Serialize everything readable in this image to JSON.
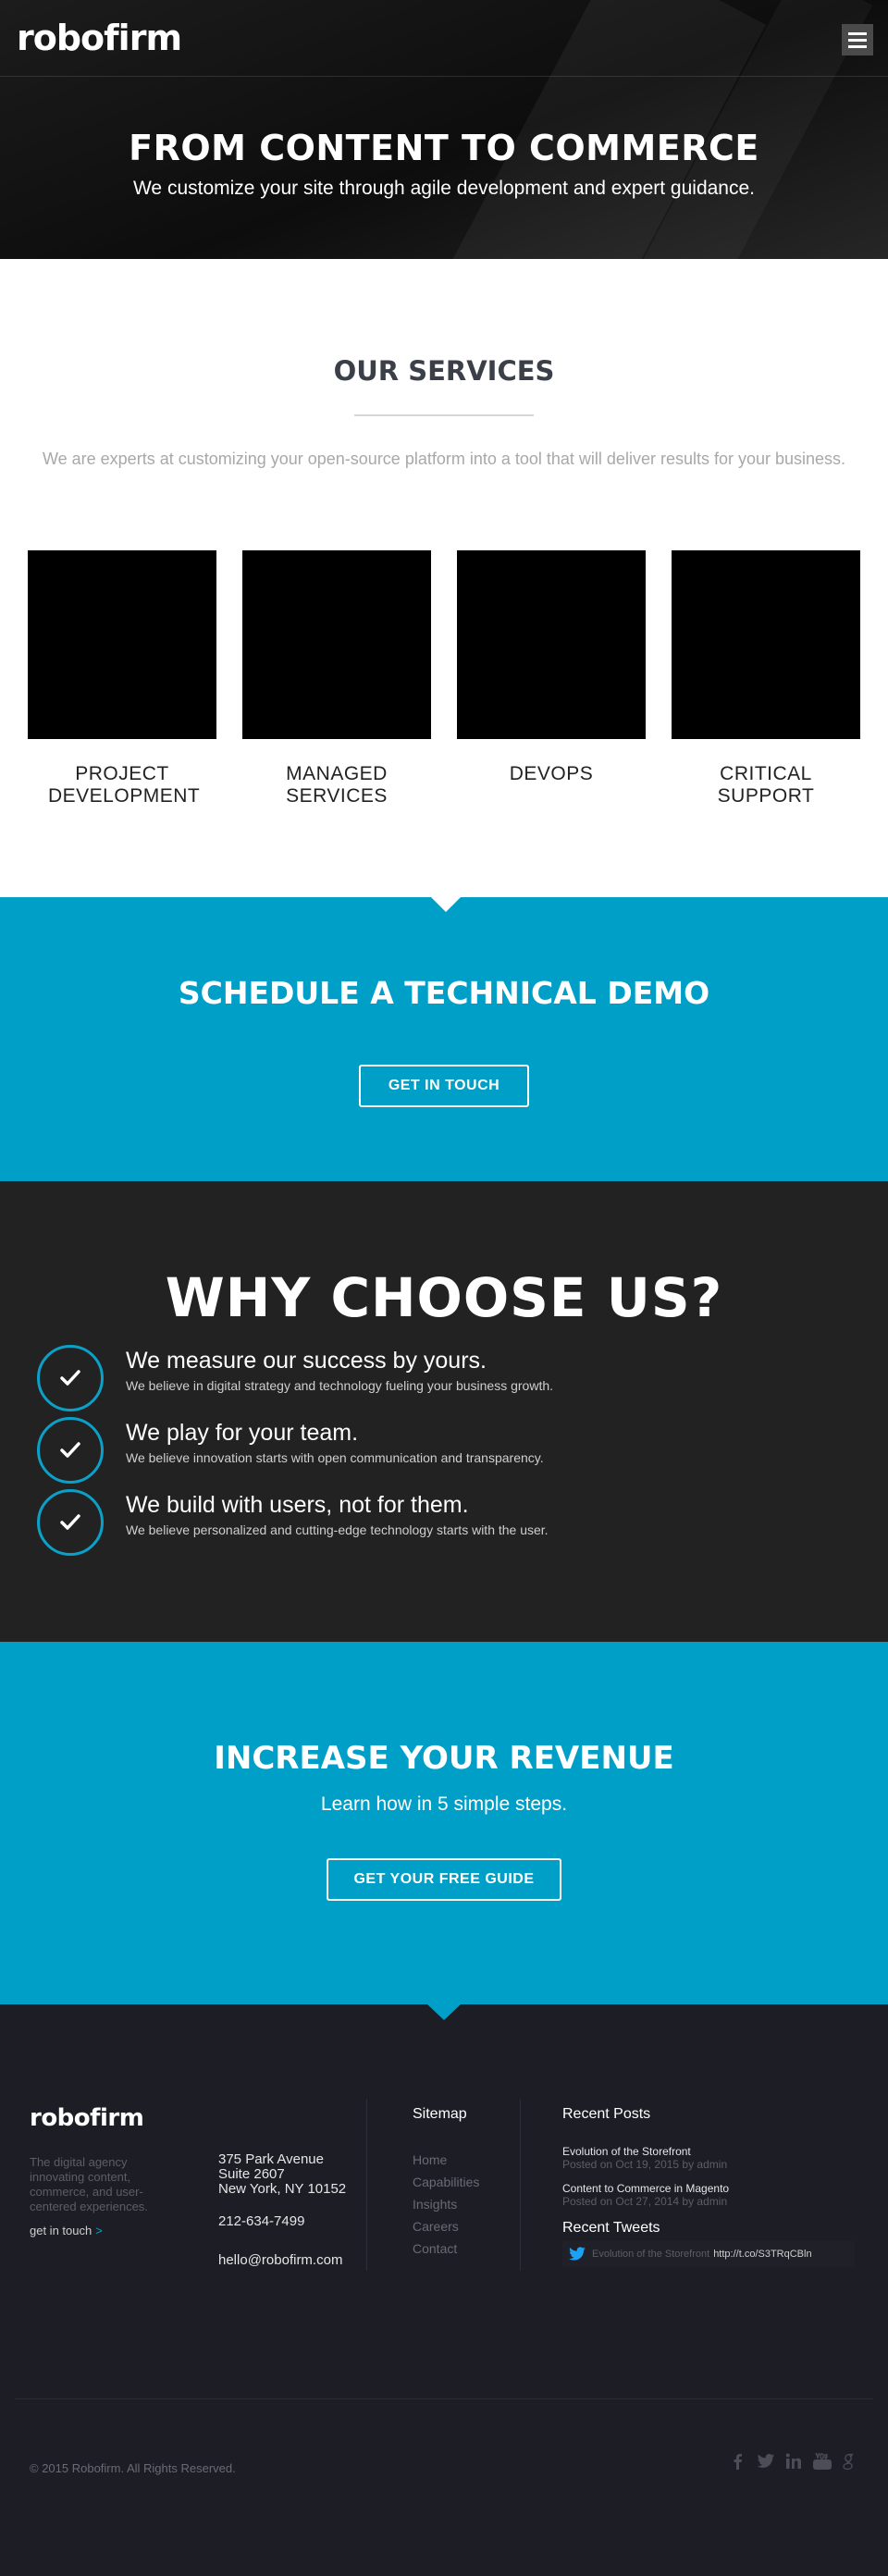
{
  "brand": {
    "logo": "robofirm",
    "accent": "#0aa0c8"
  },
  "hero": {
    "title": "FROM CONTENT TO COMMERCE",
    "subtitle": "We customize your site through agile development and expert guidance."
  },
  "services": {
    "title": "OUR SERVICES",
    "intro": "We are experts at customizing your open-source platform into a tool that will deliver results for your business.",
    "items": [
      {
        "label": "PROJECT DEVELOPMENT"
      },
      {
        "label": "MANAGED SERVICES"
      },
      {
        "label": "DEVOPS"
      },
      {
        "label": "CRITICAL SUPPORT"
      }
    ]
  },
  "demo": {
    "title": "SCHEDULE A TECHNICAL DEMO",
    "button": "GET IN TOUCH"
  },
  "why": {
    "title": "WHY CHOOSE US?",
    "items": [
      {
        "head": "We measure our success by yours.",
        "desc": "We believe in digital strategy and technology fueling your business growth."
      },
      {
        "head": "We play for your team.",
        "desc": "We believe innovation starts with open communication and transparency."
      },
      {
        "head": "We build with users, not for them.",
        "desc": "We believe personalized and cutting-edge technology starts with the user."
      }
    ]
  },
  "revenue": {
    "title": "INCREASE YOUR REVENUE",
    "subtitle": "Learn how in 5 simple steps.",
    "button": "GET YOUR FREE GUIDE"
  },
  "footer": {
    "logo": "robofirm",
    "tagline": "The digital agency innovating content, commerce, and user-centered experiences.",
    "touch": "get in touch",
    "touch_arrow": ">",
    "address": [
      "375 Park Avenue",
      "Suite 2607",
      "New York, NY 10152"
    ],
    "phone": "212-634-7499",
    "email": "hello@robofirm.com",
    "sitemap_title": "Sitemap",
    "sitemap": [
      "Home",
      "Capabilities",
      "Insights",
      "Careers",
      "Contact"
    ],
    "posts_title": "Recent Posts",
    "posts": [
      {
        "title": "Evolution of the Storefront",
        "meta": "Posted on Oct 19, 2015 by admin"
      },
      {
        "title": "Content to Commerce in Magento",
        "meta": "Posted on Oct 27, 2014 by admin"
      }
    ],
    "tweets_title": "Recent Tweets",
    "tweet_text": "Evolution of the Storefront",
    "tweet_link": "http://t.co/S3TRqCBln",
    "copyright": "© 2015 Robofirm. All Rights Reserved.",
    "social": [
      "facebook-icon",
      "twitter-icon",
      "linkedin-icon",
      "youtube-icon",
      "google-plus-icon"
    ]
  }
}
